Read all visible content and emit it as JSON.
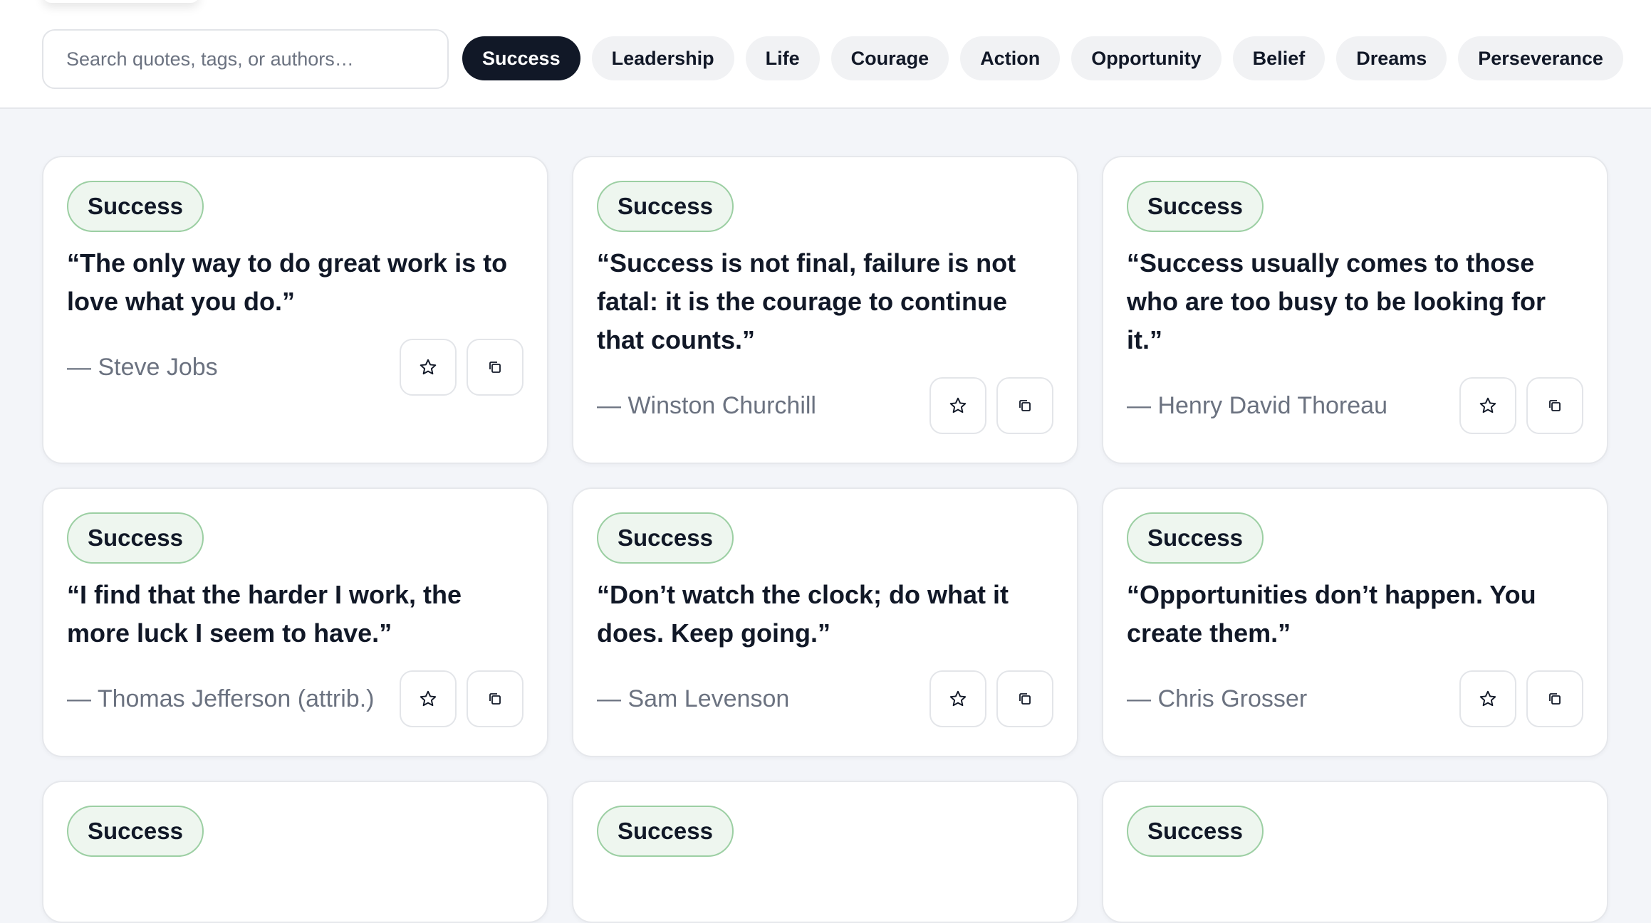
{
  "search": {
    "placeholder": "Search quotes, tags, or authors…",
    "value": ""
  },
  "chips": [
    {
      "label": "Success",
      "active": true
    },
    {
      "label": "Leadership",
      "active": false
    },
    {
      "label": "Life",
      "active": false
    },
    {
      "label": "Courage",
      "active": false
    },
    {
      "label": "Action",
      "active": false
    },
    {
      "label": "Opportunity",
      "active": false
    },
    {
      "label": "Belief",
      "active": false
    },
    {
      "label": "Dreams",
      "active": false
    },
    {
      "label": "Perseverance",
      "active": false
    }
  ],
  "cards": [
    {
      "tag": "Success",
      "quote": "“The only way to do great work is to love what you do.”",
      "author": "— Steve Jobs"
    },
    {
      "tag": "Success",
      "quote": "“Success is not final, failure is not fatal: it is the courage to continue that counts.”",
      "author": "— Winston Churchill"
    },
    {
      "tag": "Success",
      "quote": "“Success usually comes to those who are too busy to be looking for it.”",
      "author": "— Henry David Thoreau"
    },
    {
      "tag": "Success",
      "quote": "“I find that the harder I work, the more luck I seem to have.”",
      "author": "— Thomas Jefferson (attrib.)"
    },
    {
      "tag": "Success",
      "quote": "“Don’t watch the clock; do what it does. Keep going.”",
      "author": "— Sam Levenson"
    },
    {
      "tag": "Success",
      "quote": "“Opportunities don’t happen. You create them.”",
      "author": "— Chris Grosser"
    },
    {
      "tag": "Success"
    },
    {
      "tag": "Success"
    },
    {
      "tag": "Success"
    }
  ],
  "icons": {
    "favorite": "star-icon",
    "copy": "copy-icon"
  },
  "colors": {
    "active_chip": "#111827",
    "tag_border": "#9ccfa3",
    "tag_bg": "#eef6ef",
    "author": "#6b7280"
  }
}
